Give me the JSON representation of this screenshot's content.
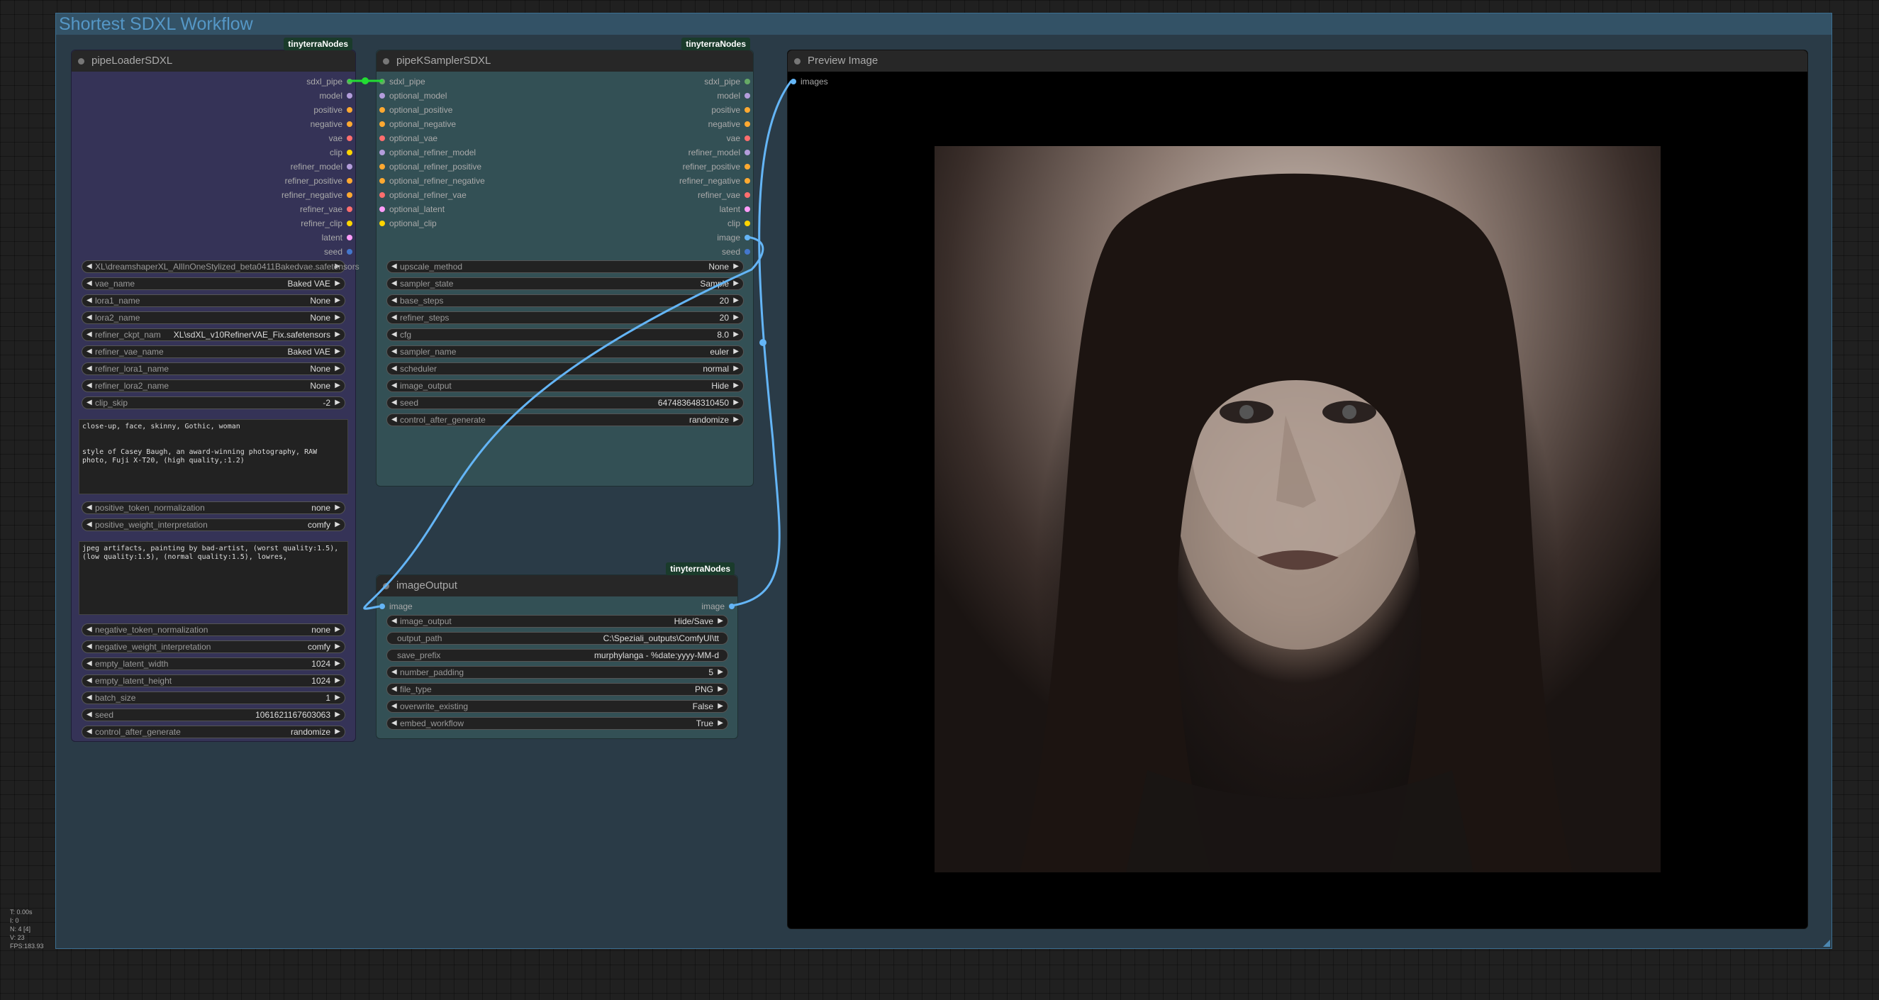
{
  "group": {
    "title": "Shortest SDXL Workflow"
  },
  "colors": {
    "pin_green": "#6a6",
    "pin_lavender": "#b39ddb",
    "pin_orange": "#ffa931",
    "pin_red": "#ff6e6e",
    "pin_yellow": "#ffd500",
    "pin_pink": "#ff9cf9",
    "pin_blue": "#64b5f6",
    "link_blue": "#64b5f6",
    "link_green": "#22dd33"
  },
  "pipe_loader": {
    "badge": "tinyterraNodes",
    "title": "pipeLoaderSDXL",
    "outputs": [
      "sdxl_pipe",
      "model",
      "positive",
      "negative",
      "vae",
      "clip",
      "refiner_model",
      "refiner_positive",
      "refiner_negative",
      "refiner_vae",
      "refiner_clip",
      "latent",
      "seed"
    ],
    "widgets_top": [
      {
        "label": "XL\\dreamshaperXL_AllInOneStylized_beta0411Bakedvae.safetensors",
        "value": ""
      },
      {
        "label": "vae_name",
        "value": "Baked VAE"
      },
      {
        "label": "lora1_name",
        "value": "None"
      },
      {
        "label": "lora2_name",
        "value": "None"
      },
      {
        "label": "refiner_ckpt_nam",
        "value": "XL\\sdXL_v10RefinerVAE_Fix.safetensors"
      },
      {
        "label": "refiner_vae_name",
        "value": "Baked VAE"
      },
      {
        "label": "refiner_lora1_name",
        "value": "None"
      },
      {
        "label": "refiner_lora2_name",
        "value": "None"
      },
      {
        "label": "clip_skip",
        "value": "-2"
      }
    ],
    "positive_text": "close-up, face, skinny, Gothic, woman\n\n\nstyle of Casey Baugh, an award-winning photography, RAW photo, Fuji X-T20, (high quality,:1.2)",
    "widgets_mid": [
      {
        "label": "positive_token_normalization",
        "value": "none"
      },
      {
        "label": "positive_weight_interpretation",
        "value": "comfy"
      }
    ],
    "negative_text": "jpeg artifacts, painting by bad-artist, (worst quality:1.5), (low quality:1.5), (normal quality:1.5), lowres,",
    "widgets_bottom": [
      {
        "label": "negative_token_normalization",
        "value": "none"
      },
      {
        "label": "negative_weight_interpretation",
        "value": "comfy"
      },
      {
        "label": "empty_latent_width",
        "value": "1024"
      },
      {
        "label": "empty_latent_height",
        "value": "1024"
      },
      {
        "label": "batch_size",
        "value": "1"
      },
      {
        "label": "seed",
        "value": "1061621167603063"
      },
      {
        "label": "control_after_generate",
        "value": "randomize"
      }
    ]
  },
  "ksampler": {
    "badge": "tinyterraNodes",
    "title": "pipeKSamplerSDXL",
    "inputs": [
      "sdxl_pipe",
      "optional_model",
      "optional_positive",
      "optional_negative",
      "optional_vae",
      "optional_refiner_model",
      "optional_refiner_positive",
      "optional_refiner_negative",
      "optional_refiner_vae",
      "optional_latent",
      "optional_clip"
    ],
    "outputs": [
      "sdxl_pipe",
      "model",
      "positive",
      "negative",
      "vae",
      "refiner_model",
      "refiner_positive",
      "refiner_negative",
      "refiner_vae",
      "latent",
      "clip",
      "image",
      "seed"
    ],
    "widgets": [
      {
        "label": "upscale_method",
        "value": "None"
      },
      {
        "label": "sampler_state",
        "value": "Sample"
      },
      {
        "label": "base_steps",
        "value": "20"
      },
      {
        "label": "refiner_steps",
        "value": "20"
      },
      {
        "label": "cfg",
        "value": "8.0"
      },
      {
        "label": "sampler_name",
        "value": "euler"
      },
      {
        "label": "scheduler",
        "value": "normal"
      },
      {
        "label": "image_output",
        "value": "Hide"
      },
      {
        "label": "seed",
        "value": "647483648310450"
      },
      {
        "label": "control_after_generate",
        "value": "randomize"
      }
    ]
  },
  "image_output": {
    "badge": "tinyterraNodes",
    "title": "imageOutput",
    "input": "image",
    "output": "image",
    "widgets": [
      {
        "label": "image_output",
        "value": "Hide/Save",
        "type": "combo"
      },
      {
        "label": "output_path",
        "value": "C:\\Speziali_outputs\\ComfyUI\\tt",
        "type": "text"
      },
      {
        "label": "save_prefix",
        "value": "murphylanga -  %date:yyyy-MM-d",
        "type": "text"
      },
      {
        "label": "number_padding",
        "value": "5",
        "type": "combo"
      },
      {
        "label": "file_type",
        "value": "PNG",
        "type": "combo"
      },
      {
        "label": "overwrite_existing",
        "value": "False",
        "type": "combo"
      },
      {
        "label": "embed_workflow",
        "value": "True",
        "type": "combo"
      }
    ]
  },
  "preview": {
    "title": "Preview Image",
    "input": "images"
  },
  "stats": [
    "T: 0.00s",
    "I: 0",
    "N: 4 [4]",
    "V: 23",
    "FPS:183.93"
  ]
}
